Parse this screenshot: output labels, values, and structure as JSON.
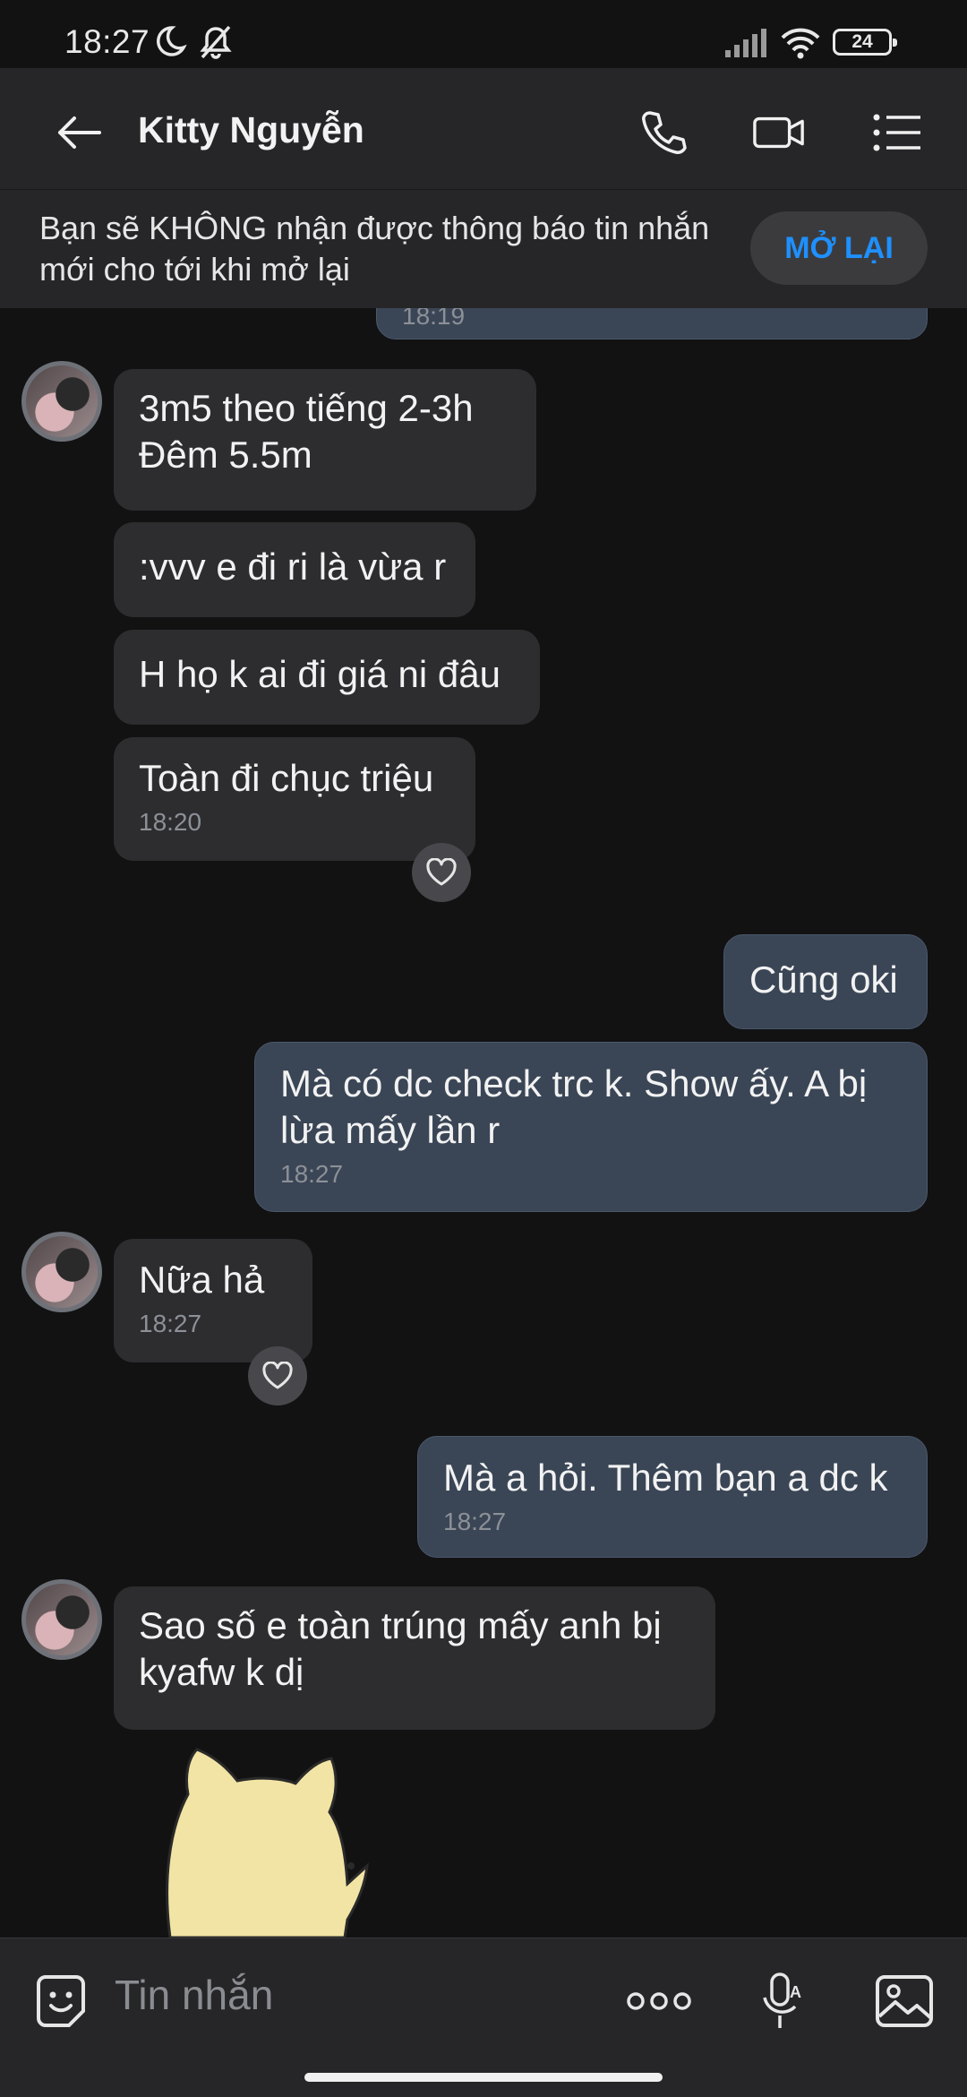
{
  "status_bar": {
    "time": "18:27",
    "battery": "24"
  },
  "header": {
    "title": "Kitty Nguyễn"
  },
  "mute_banner": {
    "text": "Bạn sẽ KHÔNG nhận được thông báo tin nhắn mới cho tới khi mở lại",
    "button_label": "MỞ LẠI"
  },
  "messages": [
    {
      "direction": "out",
      "text": "",
      "time": "18:19"
    },
    {
      "direction": "in",
      "text": "3m5 theo tiếng 2-3h\nĐêm 5.5m",
      "time": ""
    },
    {
      "direction": "in",
      "text": ":vvv e đi ri là vừa r",
      "time": ""
    },
    {
      "direction": "in",
      "text": "H họ k ai đi giá ni đâu",
      "time": ""
    },
    {
      "direction": "in",
      "text": "Toàn đi chục triệu",
      "time": "18:20"
    },
    {
      "direction": "out",
      "text": "Cũng oki",
      "time": ""
    },
    {
      "direction": "out",
      "text": "Mà có dc check trc k. Show ấy. A bị lừa mấy lần r",
      "time": "18:27"
    },
    {
      "direction": "in",
      "text": "Nữa hả",
      "time": "18:27"
    },
    {
      "direction": "out",
      "text": "Mà a hỏi. Thêm bạn a dc k",
      "time": "18:27"
    },
    {
      "direction": "in",
      "text": "Sao số e toàn trúng mấy anh bị kyafw k dị",
      "time": ""
    }
  ],
  "input": {
    "placeholder": "Tin nhắn"
  },
  "colors": {
    "accent": "#1e90ff",
    "incoming_bubble": "#2d2d30",
    "outgoing_bubble": "#3a4656",
    "background": "#121213"
  }
}
